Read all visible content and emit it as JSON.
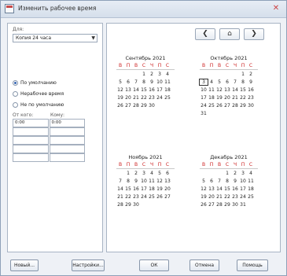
{
  "window": {
    "title": "Изменить рабочее время"
  },
  "left": {
    "for_label": "Для:",
    "calendar_value": "Копия 24 часа",
    "radios": [
      {
        "label": "По умолчанию",
        "selected": true
      },
      {
        "label": "Нерабочее время",
        "selected": false
      },
      {
        "label": "Не по умолчанию",
        "selected": false
      }
    ],
    "from_label": "От кого:",
    "to_label": "Кому:",
    "time_rows": [
      {
        "from": "0:00",
        "to": "0:00"
      },
      {
        "from": "",
        "to": ""
      },
      {
        "from": "",
        "to": ""
      },
      {
        "from": "",
        "to": ""
      },
      {
        "from": "",
        "to": ""
      }
    ]
  },
  "nav": {
    "prev_icon": "chevron-left-icon",
    "home_icon": "home-icon",
    "next_icon": "chevron-right-icon"
  },
  "weekdays": [
    "В",
    "П",
    "В",
    "С",
    "Ч",
    "П",
    "С"
  ],
  "months": [
    {
      "title": "Сентябрь 2021",
      "weeks": [
        [
          "",
          "",
          "",
          "1",
          "2",
          "3",
          "4"
        ],
        [
          "5",
          "6",
          "7",
          "8",
          "9",
          "10",
          "11"
        ],
        [
          "12",
          "13",
          "14",
          "15",
          "16",
          "17",
          "18"
        ],
        [
          "19",
          "20",
          "21",
          "22",
          "23",
          "24",
          "25"
        ],
        [
          "26",
          "27",
          "28",
          "29",
          "30",
          "",
          ""
        ]
      ]
    },
    {
      "title": "Октябрь 2021",
      "weeks": [
        [
          "",
          "",
          "",
          "",
          "",
          "1",
          "2"
        ],
        [
          "3",
          "4",
          "5",
          "6",
          "7",
          "8",
          "9"
        ],
        [
          "10",
          "11",
          "12",
          "13",
          "14",
          "15",
          "16"
        ],
        [
          "17",
          "18",
          "19",
          "20",
          "21",
          "22",
          "23"
        ],
        [
          "24",
          "25",
          "26",
          "27",
          "28",
          "29",
          "30"
        ],
        [
          "31",
          "",
          "",
          "",
          "",
          "",
          ""
        ]
      ],
      "selected": "3"
    },
    {
      "title": "Ноябрь 2021",
      "weeks": [
        [
          "",
          "1",
          "2",
          "3",
          "4",
          "5",
          "6"
        ],
        [
          "7",
          "8",
          "9",
          "10",
          "11",
          "12",
          "13"
        ],
        [
          "14",
          "15",
          "16",
          "17",
          "18",
          "19",
          "20"
        ],
        [
          "21",
          "22",
          "23",
          "24",
          "25",
          "26",
          "27"
        ],
        [
          "28",
          "29",
          "30",
          "",
          "",
          "",
          ""
        ]
      ]
    },
    {
      "title": "Декабрь 2021",
      "weeks": [
        [
          "",
          "",
          "",
          "1",
          "2",
          "3",
          "4"
        ],
        [
          "5",
          "6",
          "7",
          "8",
          "9",
          "10",
          "11"
        ],
        [
          "12",
          "13",
          "14",
          "15",
          "16",
          "17",
          "18"
        ],
        [
          "19",
          "20",
          "21",
          "22",
          "23",
          "24",
          "25"
        ],
        [
          "26",
          "27",
          "28",
          "29",
          "30",
          "31",
          ""
        ]
      ]
    }
  ],
  "buttons": {
    "new": "Новый...",
    "settings": "Настройки...",
    "ok": "ОК",
    "cancel": "Отмена",
    "help": "Помощь"
  }
}
